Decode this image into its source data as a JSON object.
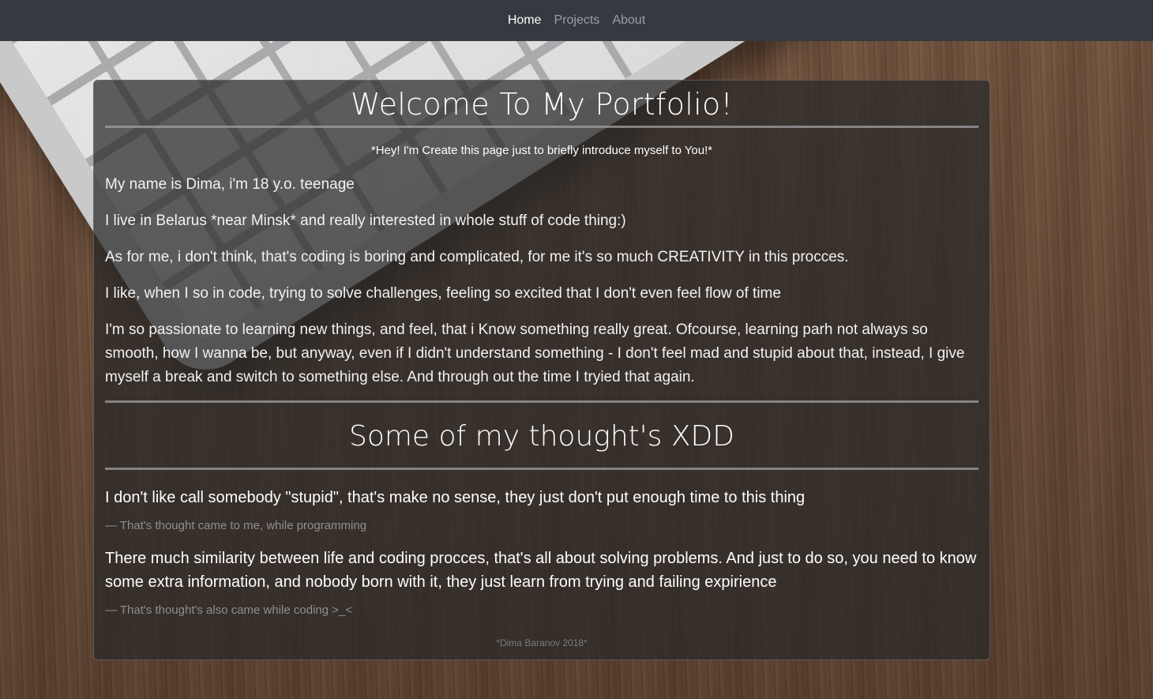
{
  "nav": {
    "items": [
      {
        "label": "Home"
      },
      {
        "label": "Projects"
      },
      {
        "label": "About"
      }
    ]
  },
  "main": {
    "title": "Welcome To My Portfolio!",
    "intro": "*Hey! I'm Create this page just to briefly introduce myself to You!*",
    "paragraphs": [
      "My name is Dima, i'm 18 y.o. teenage",
      "I live in Belarus *near Minsk* and really interested in whole stuff of code thing:)",
      "As for me, i don't think, that's coding is boring and complicated, for me it's so much CREATIVITY in this procces.",
      "I like, when I so in code, trying to solve challenges, feeling so excited that I don't even feel flow of time",
      "I'm so passionate to learning new things, and feel, that i Know something really great. Ofcourse, learning parh not always so smooth, how I wanna be, but anyway, even if I didn't understand something - I don't feel mad and stupid about that, instead, I give myself a break and switch to something else. And through out the time I tryied that again."
    ],
    "thoughts_title": "Some of my thought's XDD",
    "quotes": [
      {
        "text": "I don't like call somebody \"stupid\", that's make no sense, they just don't put enough time to this thing",
        "cite": "— That's thought came to me, while programming"
      },
      {
        "text": "There much similarity between life and coding procces, that's all about solving problems. And just to do so, you need to know some extra information, and nobody born with it, they just learn from trying and failing expirience",
        "cite": "— That's thought's also came while coding >_<"
      }
    ],
    "footer": "*Dima Baranov 2018*"
  }
}
